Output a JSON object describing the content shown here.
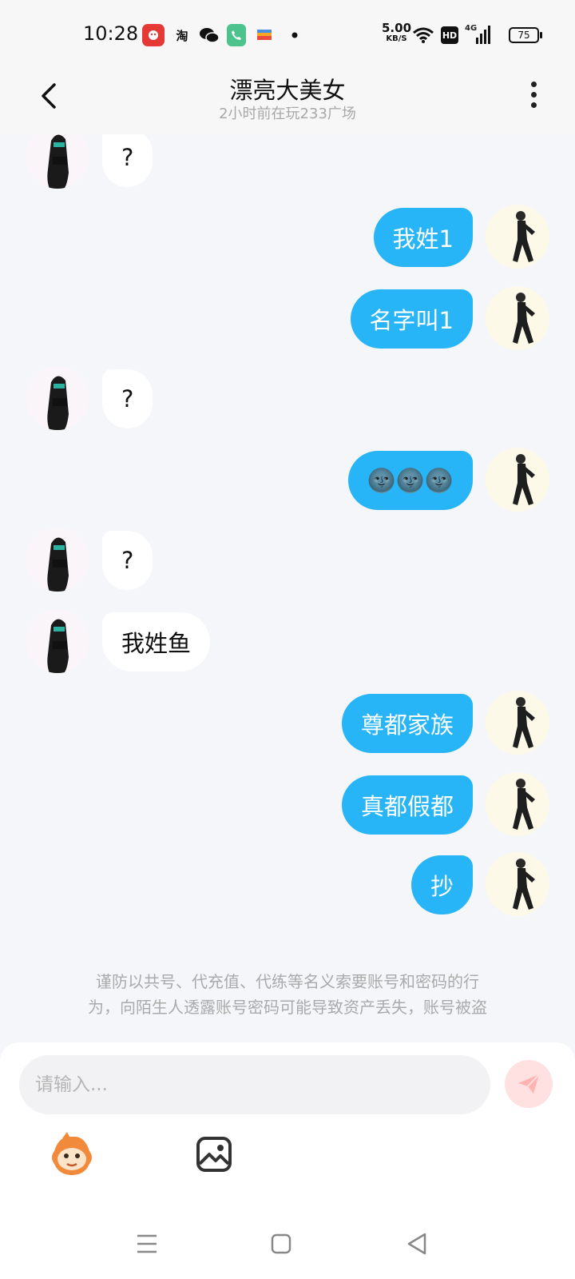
{
  "status_bar": {
    "time": "10:28",
    "app_icons": [
      "app-notification-icon",
      "taobao-icon",
      "wechat-icon",
      "phone-icon",
      "wallet-icon"
    ],
    "taobao_label": "淘",
    "net_speed": "5.00",
    "net_speed_unit": "KB/S",
    "hd_label": "HD",
    "network_label": "4G",
    "battery": "75"
  },
  "header": {
    "title": "漂亮大美女",
    "subtitle": "2小时前在玩233广场"
  },
  "messages": [
    {
      "side": "left",
      "text": "?"
    },
    {
      "side": "right",
      "text": "我姓1"
    },
    {
      "side": "right",
      "text": "名字叫1"
    },
    {
      "side": "left",
      "text": "?"
    },
    {
      "side": "right",
      "text": "🌚🌚🌚"
    },
    {
      "side": "left",
      "text": "?"
    },
    {
      "side": "left",
      "text": "我姓鱼"
    },
    {
      "side": "right",
      "text": "尊都家族"
    },
    {
      "side": "right",
      "text": "真都假都"
    },
    {
      "side": "right",
      "text": "抄"
    }
  ],
  "notice": {
    "line1": "谨防以共号、代充值、代练等名义索要账号和密码的行",
    "line2": "为，向陌生人透露账号密码可能导致资产丢失，账号被盗"
  },
  "composer": {
    "placeholder": "请输入..."
  },
  "colors": {
    "outgoing_bubble": "#27b5f7",
    "incoming_bubble": "#ffffff",
    "send_button": "#ffe1e1",
    "send_icon": "#ffb3b3"
  }
}
